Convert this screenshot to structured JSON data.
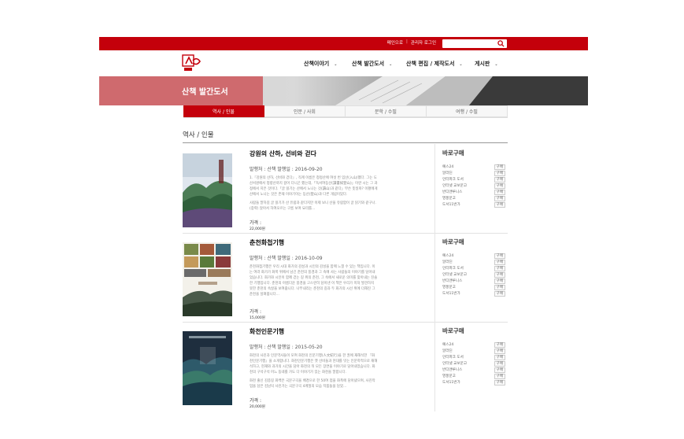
{
  "topbar": {
    "links": [
      "메인으로",
      "관리자 로그인"
    ],
    "separator": "|"
  },
  "logo": {
    "text": "산책"
  },
  "nav": [
    {
      "label": "산책이야기"
    },
    {
      "label": "산책 발간도서"
    },
    {
      "label": "산책 편집 / 제작도서"
    },
    {
      "label": "게시판"
    }
  ],
  "hero": {
    "title": "산책 발간도서"
  },
  "tabs": [
    {
      "label": "역사 / 인물",
      "active": true
    },
    {
      "label": "인문 / 사회",
      "active": false
    },
    {
      "label": "문학 / 수필",
      "active": false
    },
    {
      "label": "여행 / 수필",
      "active": false
    }
  ],
  "section": {
    "title": "역사 / 인물"
  },
  "buy_button_label": "구매",
  "books": [
    {
      "title": "강원의 산하, 선비와 걷다",
      "publish": "발행처 : 산책 발행일 : 2016-09-20",
      "desc": [
        "1.『강원의 산하, 선비와 걷다』, 직계 이름은 청정산에 여섯 번 입산(入山)했다. 그는 도산서원에서 청량산까지 걸어 다니곤 했는데,「독서여등산(讀書如登山)」이란 시는 그 과정에서 지은 것이다.「글 읽기는 산에서 노니는 것(讀山)과 같다」무슨 뜻일까? 이황에게 산에서 노니는 것은 존재 이야기이는 등산(登山)과 다른 개념이었다.",
        "사람들 말하길 글 읽기가 산 유람과 같다지만 이제 보니 산을 유람함이 글 읽기와 같구나. (중략) 앉아서 하여오르는 구름 보며 묘리를..."
      ],
      "price_label": "가격 :",
      "price": "22,000원",
      "buy_title": "바로구매",
      "stores": [
        "예스24",
        "알라딘",
        "인터파크 도서",
        "인터넷 교보문고",
        "반디앤루니스",
        "영풍문고",
        "도서11번가"
      ]
    },
    {
      "title": "춘천화첩기행",
      "publish": "발행처 : 산책 발행일 : 2016-10-09",
      "desc": [
        "춘천화첩기행은 우리 시대 화가의 감성과 시인의 감성을 함께 느낄 수 있는 책입니다. 이는 여러 화가가 화폭 위에서 남긴 춘천의 풍경과 그 속에 사는 사람들의 이야기를 담아내었습니다. 화가와 시인이 함께 걷는 길 위의 춘천, 그 속에서 새로운 의미를 찾아내는 진솔한 기행입니다. 춘천의 아름다운 풍경을 고스란히 담아낸 이 책은 우리가 미처 발견하지 못한 춘천의 속살을 보여줍니다. 나무내리는 춘천의 길과 두 화가의 시선 위에 더해진 그 춘천을 살펴봅니다..."
      ],
      "price_label": "가격 :",
      "price": "15,000원",
      "buy_title": "바로구매",
      "stores": [
        "예스24",
        "알라딘",
        "인터파크 도서",
        "인터넷 교보문고",
        "반디앤루니스",
        "영풍문고",
        "도서11번가"
      ]
    },
    {
      "title": "화천인문기행",
      "publish": "발행처 : 산책 발행일 : 2015-05-20",
      "desc": [
        "화천의 사진과 인문역사들이 모여 화천의 인문기행(人文紀行)을 한 권에 재해석한 『화천인문기행』을 소개합니다. 화천인문기행은 옛 선비들과 현대를 잇는 인문학적으로 재해석하고, 현재와 과거의 시간을 담아 화천의 뒤 모든 장면을 이야기로 담아내었습니다. 화천의 구석구석 어느 동네를 가도 다 이야기가 있는 화천을 말합니다.",
        "화천 출신 김종길 화백은 국문구곡을 배경으로 한 50여 점을 화폭에 담아냈으며, 사진작업을 담은 김남덕 사진가는 국문구곡 4계절의 모습 작품들을 담았..."
      ],
      "price_label": "가격 :",
      "price": "20,000원",
      "buy_title": "바로구매",
      "stores": [
        "예스24",
        "알라딘",
        "인터파크 도서",
        "인터넷 교보문고",
        "반디앤루니스",
        "영풍문고",
        "도서11번가"
      ]
    }
  ]
}
